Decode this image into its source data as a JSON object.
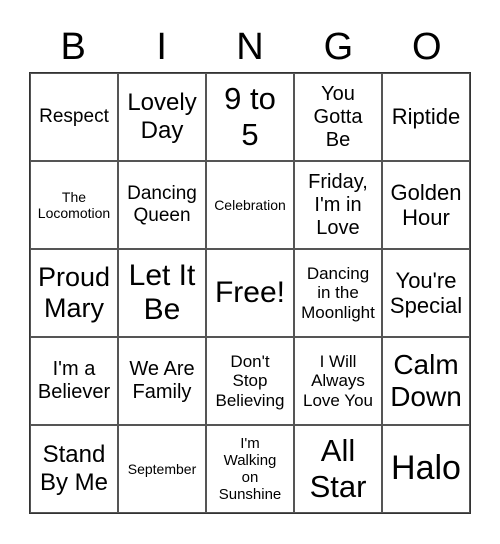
{
  "header": [
    "B",
    "I",
    "N",
    "G",
    "O"
  ],
  "cells": [
    "Respect",
    "Lovely\nDay",
    "9 to\n5",
    "You\nGotta\nBe",
    "Riptide",
    "The\nLocomotion",
    "Dancing\nQueen",
    "Celebration",
    "Friday,\nI'm in\nLove",
    "Golden\nHour",
    "Proud\nMary",
    "Let It\nBe",
    "Free!",
    "Dancing\nin the\nMoonlight",
    "You're\nSpecial",
    "I'm a\nBeliever",
    "We Are\nFamily",
    "Don't\nStop\nBelieving",
    "I Will\nAlways\nLove You",
    "Calm\nDown",
    "Stand\nBy Me",
    "September",
    "I'm\nWalking\non\nSunshine",
    "All\nStar",
    "Halo"
  ]
}
